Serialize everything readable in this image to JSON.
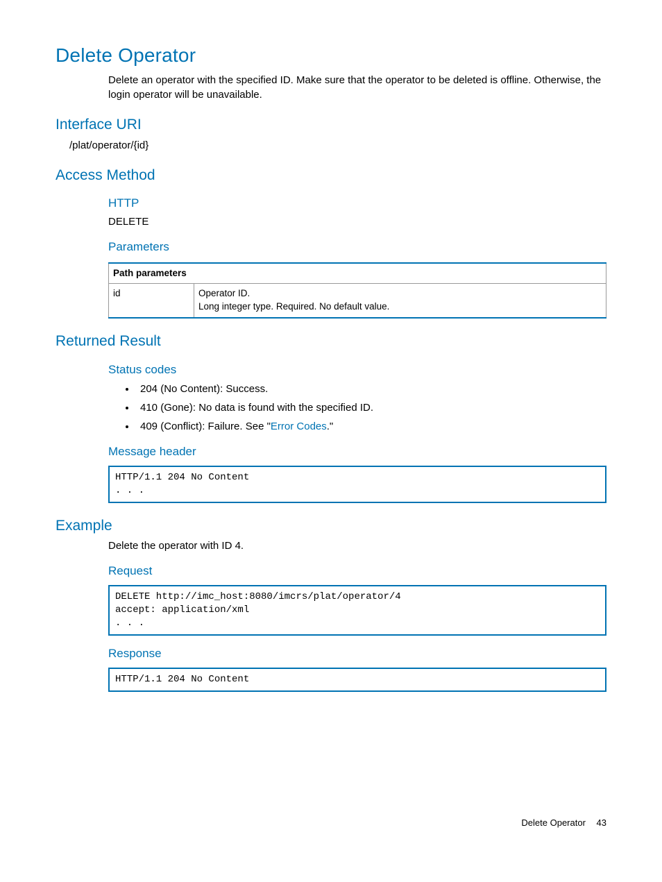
{
  "title": "Delete Operator",
  "intro": "Delete an operator with the specified ID. Make sure that the operator to be deleted is offline. Otherwise, the login operator will be unavailable.",
  "interface_uri": {
    "heading": "Interface URI",
    "value": "/plat/operator/{id}"
  },
  "access_method": {
    "heading": "Access Method",
    "http_heading": "HTTP",
    "http_value": "DELETE",
    "parameters_heading": "Parameters",
    "table_header": "Path parameters",
    "param_name": "id",
    "param_desc1": "Operator ID.",
    "param_desc2": "Long integer type. Required. No default value."
  },
  "returned_result": {
    "heading": "Returned Result",
    "status_heading": "Status codes",
    "status_items": [
      "204 (No Content): Success.",
      "410 (Gone): No data is found with the specified ID."
    ],
    "status_item3_prefix": "409 (Conflict): Failure. See \"",
    "status_item3_link": "Error Codes",
    "status_item3_suffix": ".\"",
    "msg_heading": "Message header",
    "msg_code": "HTTP/1.1 204 No Content\n. . ."
  },
  "example": {
    "heading": "Example",
    "intro": "Delete the operator with ID 4.",
    "request_heading": "Request",
    "request_code": "DELETE http://imc_host:8080/imcrs/plat/operator/4\naccept: application/xml\n. . .",
    "response_heading": "Response",
    "response_code": "HTTP/1.1 204 No Content"
  },
  "footer": {
    "text": "Delete Operator",
    "page": "43"
  }
}
